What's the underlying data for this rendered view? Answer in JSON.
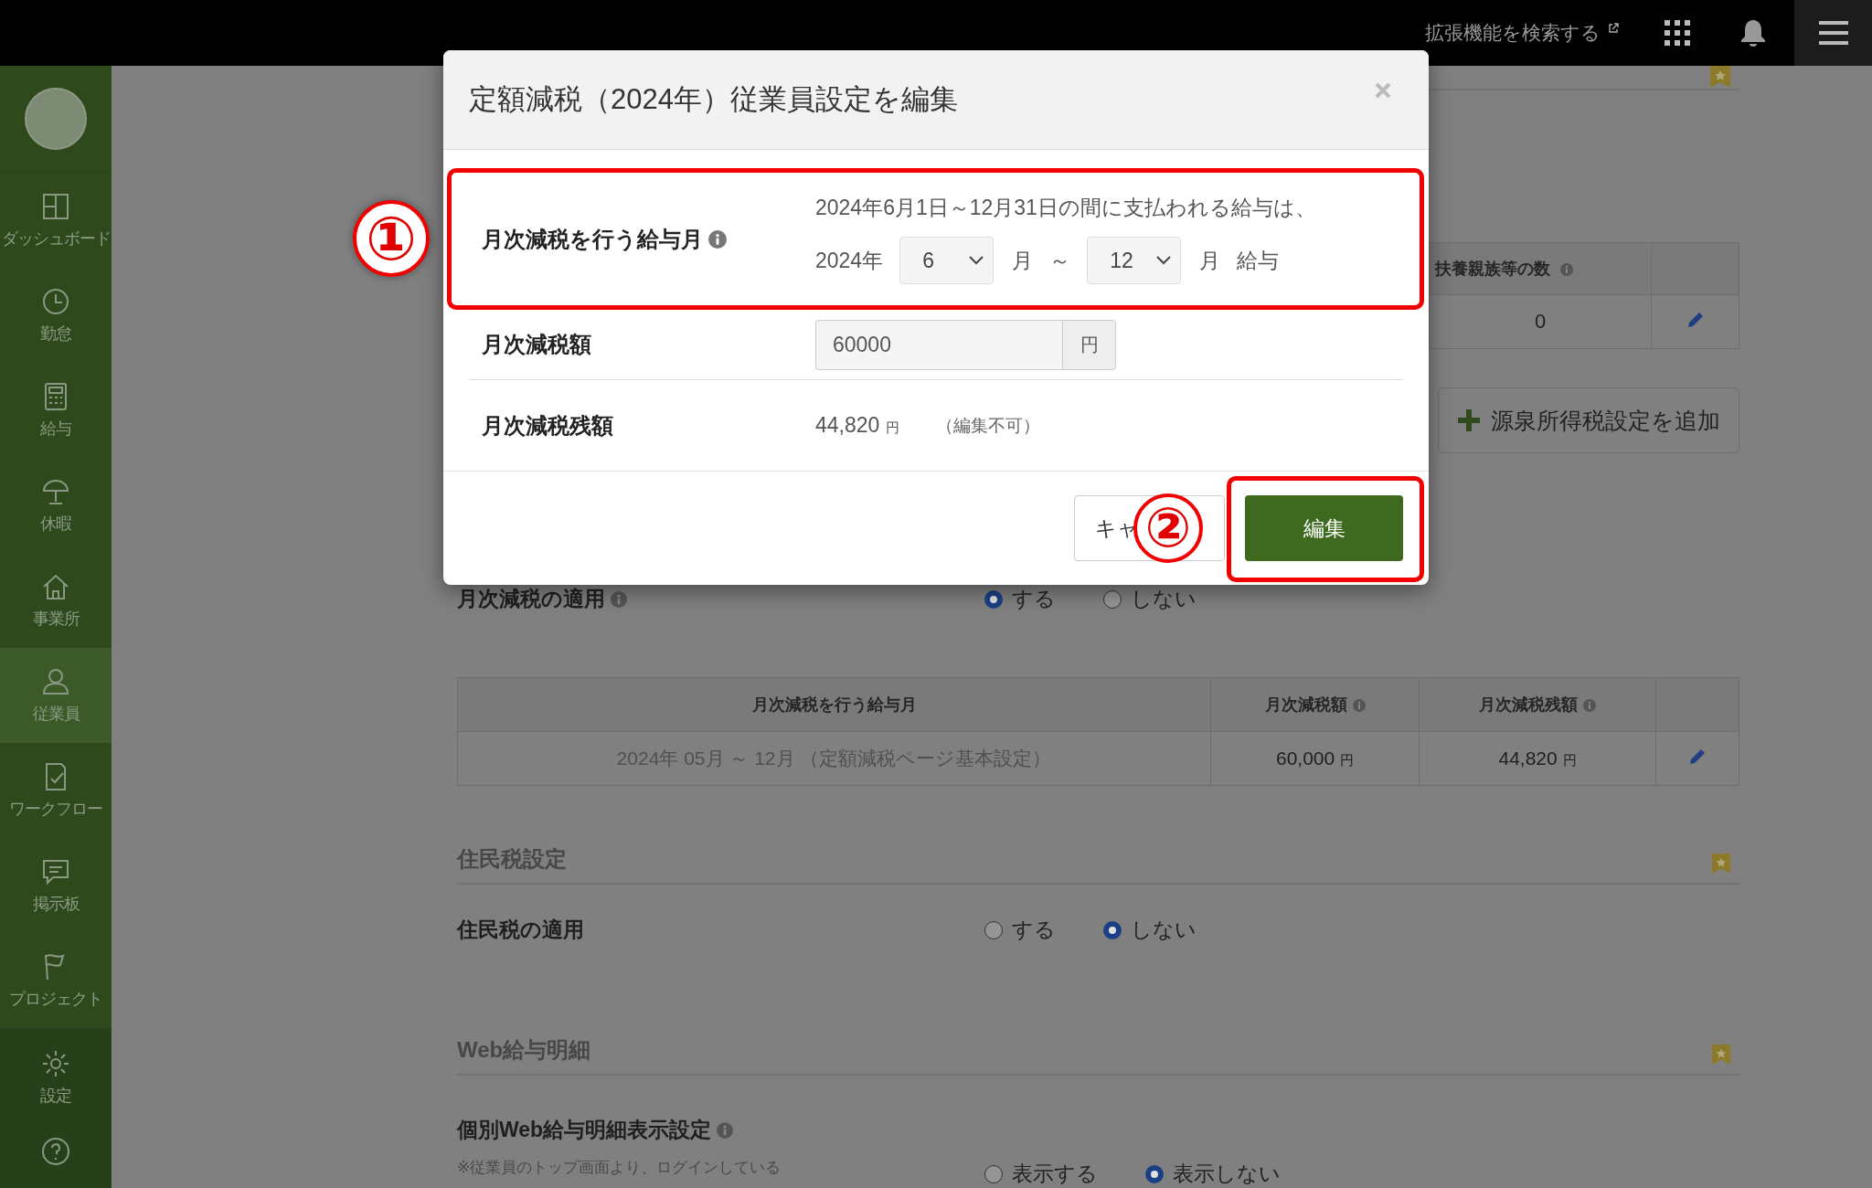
{
  "top_bar": {
    "extension_link": "拡張機能を検索する"
  },
  "sidebar": {
    "items": [
      {
        "label": "ダッシュボード",
        "selected": false
      },
      {
        "label": "勤怠",
        "selected": false
      },
      {
        "label": "給与",
        "selected": false
      },
      {
        "label": "休暇",
        "selected": false
      },
      {
        "label": "事業所",
        "selected": false
      },
      {
        "label": "従業員",
        "selected": true
      },
      {
        "label": "ワークフロー",
        "selected": false
      },
      {
        "label": "掲示板",
        "selected": false
      },
      {
        "label": "プロジェクト",
        "selected": false
      },
      {
        "label": "設定",
        "selected": false
      }
    ]
  },
  "background": {
    "dependents_table": {
      "columns": [
        "扶養親族等の数"
      ],
      "rows": [
        [
          "0"
        ]
      ]
    },
    "add_button": "源泉所得税設定を追加",
    "monthly_reduction": {
      "label": "月次減税の適用",
      "options": [
        {
          "label": "する",
          "selected": true
        },
        {
          "label": "しない",
          "selected": false
        }
      ]
    },
    "reduction_table": {
      "columns": [
        "月次減税を行う給与月",
        "月次減税額",
        "月次減税残額"
      ],
      "rows": [
        {
          "period": "2024年 05月 ～ 12月 （定額減税ページ基本設定）",
          "amount": "60,000",
          "amount_unit": "円",
          "remaining": "44,820",
          "remaining_unit": "円"
        }
      ]
    },
    "resident_tax": {
      "heading": "住民税設定",
      "label": "住民税の適用",
      "options": [
        {
          "label": "する",
          "selected": false
        },
        {
          "label": "しない",
          "selected": true
        }
      ]
    },
    "web_payslip": {
      "heading": "Web給与明細",
      "label": "個別Web給与明細表示設定",
      "note": "※従業員のトップ画面より、ログインしている",
      "options": [
        {
          "label": "表示する",
          "selected": false
        },
        {
          "label": "表示しない",
          "selected": true
        }
      ]
    }
  },
  "modal": {
    "title": "定額減税（2024年）従業員設定を編集",
    "pay_month": {
      "label": "月次減税を行う給与月",
      "description": "2024年6月1日～12月31日の間に支払われる給与は、",
      "year": "2024年",
      "from": "6",
      "month_1": "月",
      "tilde": "～",
      "to": "12",
      "month_2": "月",
      "suffix": "給与"
    },
    "amount": {
      "label": "月次減税額",
      "value": "60000",
      "unit": "円"
    },
    "remaining": {
      "label": "月次減税残額",
      "value": "44,820",
      "unit": "円",
      "note": "（編集不可）"
    },
    "buttons": {
      "cancel": "キャ",
      "submit": "編集"
    }
  },
  "annotations": [
    {
      "label": "①"
    },
    {
      "label": "②"
    }
  ]
}
